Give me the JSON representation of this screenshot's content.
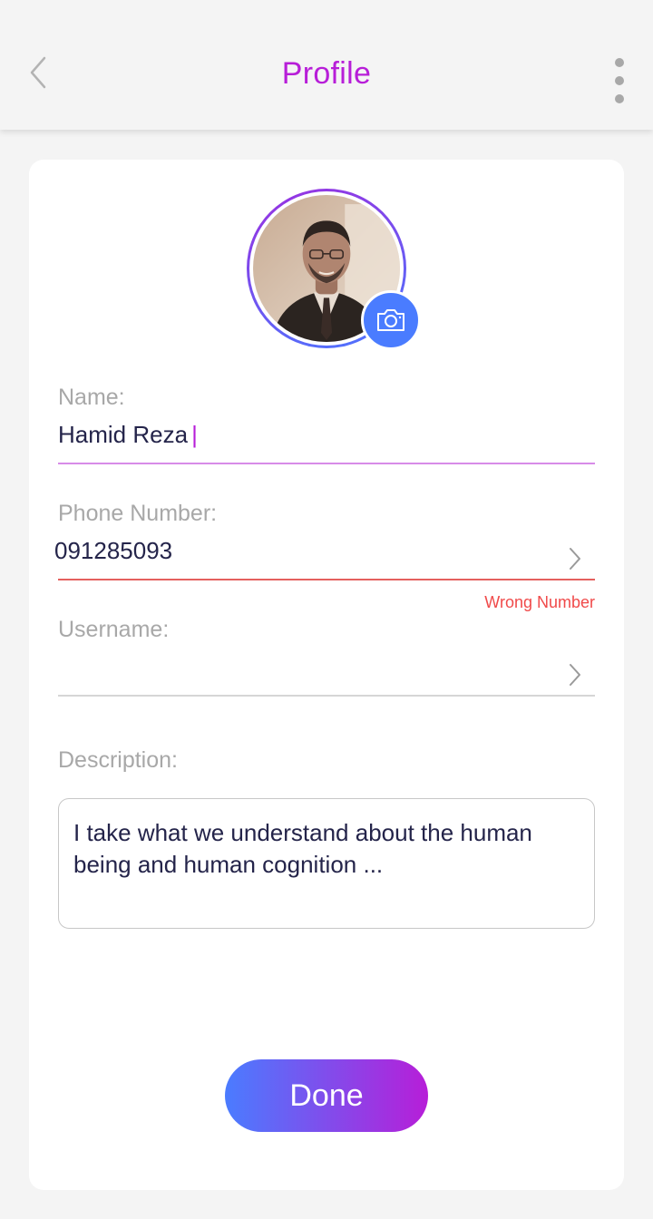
{
  "header": {
    "title": "Profile",
    "title_color": "#b71ed8",
    "back_icon": "chevron-left-icon",
    "menu_icon": "more-vertical-icon"
  },
  "profile": {
    "avatar_icon": "profile-photo",
    "camera_icon": "camera-icon",
    "ring_gradient": [
      "#9b2fe0",
      "#4a76ff"
    ],
    "camera_color": "#4a7cff"
  },
  "form": {
    "name": {
      "label": "Name:",
      "value": "Hamid Reza",
      "caret": "|",
      "underline_color": "#d78be8"
    },
    "phone": {
      "label": "Phone Number:",
      "value": "091285093",
      "error": "Wrong Number",
      "error_color": "#f04a4a",
      "underline_color": "#e4605e"
    },
    "username": {
      "label": "Username:",
      "value": "",
      "underline_color": "#d6d6d6"
    },
    "description": {
      "label": "Description:",
      "value": "I take what we understand about the human being and human cognition ..."
    }
  },
  "done_button": {
    "label": "Done",
    "gradient": [
      "#4a7cff",
      "#b71ed8"
    ]
  }
}
